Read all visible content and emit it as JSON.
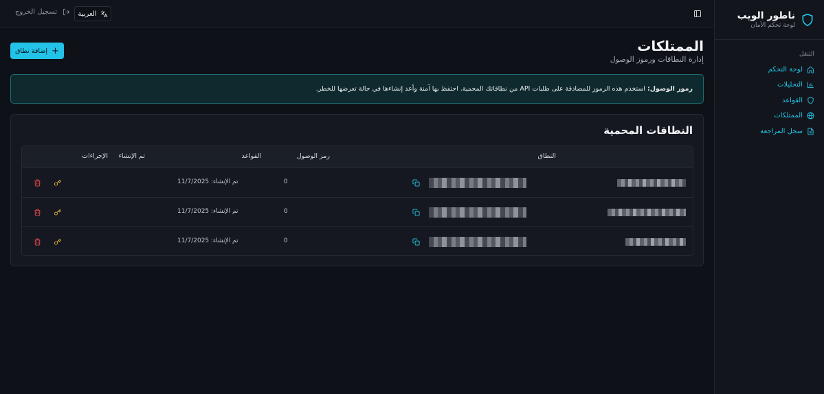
{
  "sidebar": {
    "brand_title": "ناطور الويب",
    "brand_subtitle": "لوحة تحكم الأمان",
    "nav_heading": "التنقل",
    "items": [
      {
        "label": "لوحة التحكم",
        "icon": "home-icon"
      },
      {
        "label": "التحليلات",
        "icon": "bar-chart-icon"
      },
      {
        "label": "القواعد",
        "icon": "shield-icon"
      },
      {
        "label": "الممتلكات",
        "icon": "globe-icon"
      },
      {
        "label": "سجل المراجعة",
        "icon": "document-icon"
      }
    ]
  },
  "topbar": {
    "language_label": "العربية",
    "logout_label": "تسجيل الخروج"
  },
  "page": {
    "title": "الممتلكات",
    "subtitle": "إدارة النطاقات ورموز الوصول",
    "add_button": "إضافة نطاق"
  },
  "alert": {
    "bold": "رموز الوصول:",
    "text": "استخدم هذه الرموز للمصادقة على طلبات API من نطاقاتك المحمية. احتفظ بها آمنة وأعد إنشاءها في حالة تعرضها للخطر."
  },
  "table": {
    "title": "النطاقات المحمية",
    "headers": {
      "domain": "النطاق",
      "token": "رمز الوصول",
      "rules": "القواعد",
      "created": "تم الإنشاء",
      "actions": "الإجراءات"
    },
    "rows": [
      {
        "rules": "0",
        "created": "تم الإنشاء: 11/7/2025"
      },
      {
        "rules": "0",
        "created": "تم الإنشاء: 11/7/2025"
      },
      {
        "rules": "0",
        "created": "تم الإنشاء: 11/7/2025"
      }
    ]
  },
  "colors": {
    "accent": "#22c3e6",
    "danger": "#e5484d",
    "key": "#e3b43a"
  }
}
